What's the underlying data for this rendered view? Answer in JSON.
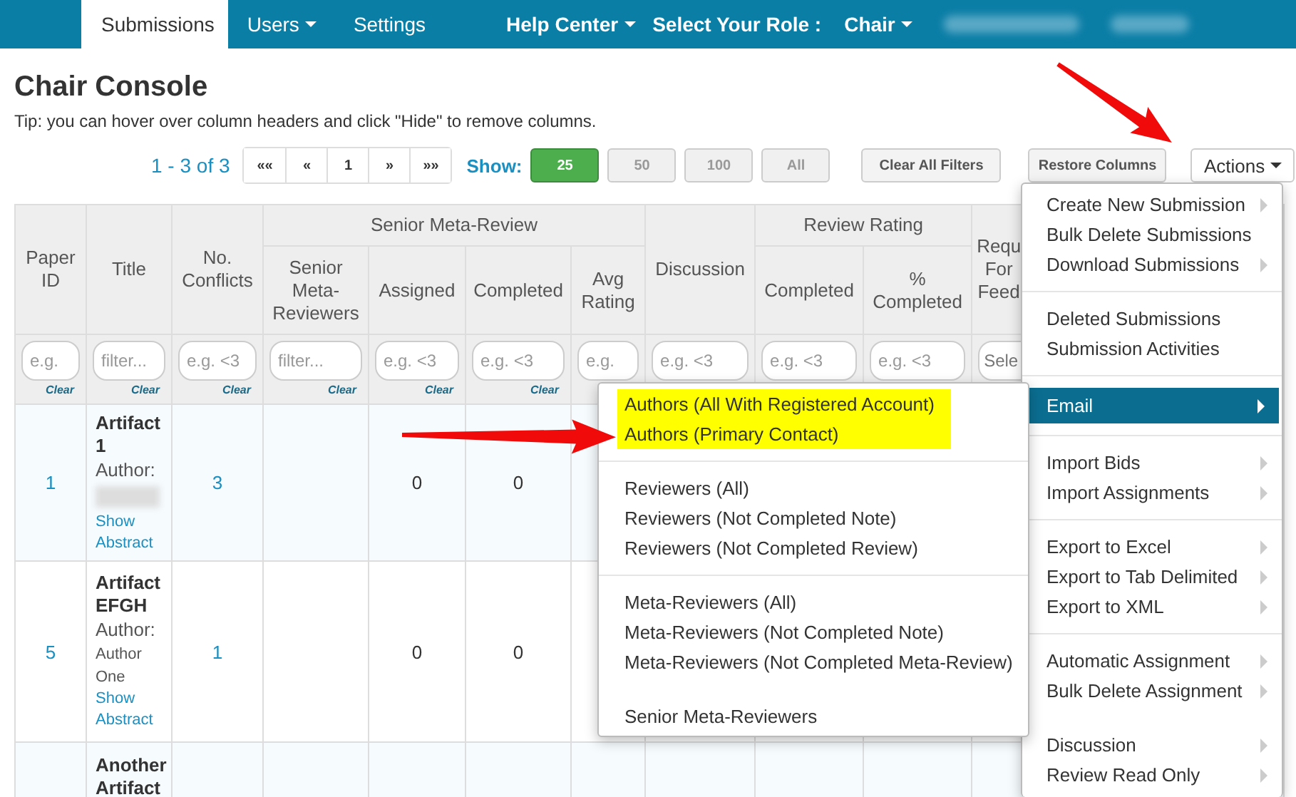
{
  "nav": {
    "tabs": [
      {
        "label": "Submissions",
        "selected": true,
        "dropdown": false
      },
      {
        "label": "Users",
        "selected": false,
        "dropdown": true
      },
      {
        "label": "Settings",
        "selected": false,
        "dropdown": false
      }
    ],
    "right": [
      {
        "kind": "link",
        "label": "Help Center",
        "dropdown": true
      },
      {
        "kind": "label",
        "label": "Select Your Role :"
      },
      {
        "kind": "link",
        "label": "Chair",
        "dropdown": true
      },
      {
        "kind": "redacted"
      },
      {
        "kind": "redacted"
      }
    ]
  },
  "page": {
    "title": "Chair Console",
    "tip": "Tip: you can hover over column headers and click \"Hide\" to remove columns."
  },
  "toolbar": {
    "range": "1 - 3 of 3",
    "pager": [
      "««",
      "«",
      "1",
      "»",
      "»»"
    ],
    "show_label": "Show:",
    "page_sizes": [
      {
        "label": "25",
        "selected": true
      },
      {
        "label": "50",
        "selected": false
      },
      {
        "label": "100",
        "selected": false
      },
      {
        "label": "All",
        "selected": false
      }
    ],
    "buttons": [
      "Clear All Filters",
      "Restore Columns"
    ],
    "actions": {
      "label": "Actions",
      "dropdown": true
    }
  },
  "table": {
    "header": [
      {
        "label": "Paper ID"
      },
      {
        "label": "Title"
      },
      {
        "label": "No. Conflicts"
      },
      {
        "group": "Senior Meta-Review",
        "columns": [
          "Senior Meta-Reviewers",
          "Assigned",
          "Completed",
          "Avg Rating"
        ]
      },
      {
        "label": "Discussion"
      },
      {
        "group": "Review Rating",
        "columns": [
          "Completed",
          "% Completed"
        ]
      },
      {
        "label": "Requ For Feed"
      }
    ],
    "filters": [
      {
        "kind": "text",
        "placeholder": "e.g.",
        "clear": "Clear"
      },
      {
        "kind": "text",
        "placeholder": "filter...",
        "clear": "Clear"
      },
      {
        "kind": "text",
        "placeholder": "e.g. <3",
        "clear": "Clear"
      },
      {
        "kind": "text",
        "placeholder": "filter...",
        "clear": "Clear"
      },
      {
        "kind": "text",
        "placeholder": "e.g. <3",
        "clear": "Clear"
      },
      {
        "kind": "text",
        "placeholder": "e.g. <3",
        "clear": "Clear"
      },
      {
        "kind": "text",
        "placeholder": "e.g."
      },
      {
        "kind": "text",
        "placeholder": "e.g. <3"
      },
      {
        "kind": "text",
        "placeholder": "e.g. <3"
      },
      {
        "kind": "text",
        "placeholder": "e.g. <3"
      },
      {
        "kind": "select",
        "value": "Sele"
      }
    ],
    "rows": [
      {
        "cells": [
          {
            "kind": "link",
            "text": "1"
          },
          {
            "kind": "paper",
            "title": "Artifact 1",
            "author_label": "Author:",
            "author_redacted": true,
            "abstract_link": "Show Abstract"
          },
          {
            "kind": "link",
            "text": "3"
          },
          {
            "kind": "empty"
          },
          {
            "kind": "number",
            "text": "0"
          },
          {
            "kind": "number",
            "text": "0"
          },
          {
            "kind": "empty"
          },
          {
            "kind": "empty"
          },
          {
            "kind": "empty"
          },
          {
            "kind": "empty"
          },
          {
            "kind": "empty"
          }
        ]
      },
      {
        "cells": [
          {
            "kind": "link",
            "text": "5"
          },
          {
            "kind": "paper",
            "title": "Artifact EFGH",
            "author_label": "Author:",
            "author": "Author One",
            "author_redacted": false,
            "abstract_link": "Show Abstract"
          },
          {
            "kind": "link",
            "text": "1"
          },
          {
            "kind": "empty"
          },
          {
            "kind": "number",
            "text": "0"
          },
          {
            "kind": "number",
            "text": "0"
          },
          {
            "kind": "empty"
          },
          {
            "kind": "empty"
          },
          {
            "kind": "empty"
          },
          {
            "kind": "empty"
          },
          {
            "kind": "empty"
          }
        ]
      },
      {
        "cells": [
          {
            "kind": "empty"
          },
          {
            "kind": "paper",
            "title": "Another Artifact"
          },
          {
            "kind": "empty"
          },
          {
            "kind": "empty"
          },
          {
            "kind": "empty"
          },
          {
            "kind": "empty"
          },
          {
            "kind": "empty"
          },
          {
            "kind": "empty"
          },
          {
            "kind": "empty"
          },
          {
            "kind": "empty"
          },
          {
            "kind": "empty"
          }
        ]
      }
    ]
  },
  "actions_menu": {
    "sections": [
      {
        "ruled": true,
        "items": [
          {
            "label": "Create New Submission",
            "submenu": true,
            "selected": false
          },
          {
            "label": "Bulk Delete Submissions",
            "submenu": false,
            "selected": false
          },
          {
            "label": "Download Submissions",
            "submenu": true,
            "selected": false
          }
        ]
      },
      {
        "ruled": true,
        "items": [
          {
            "label": "Deleted Submissions",
            "submenu": false,
            "selected": false
          },
          {
            "label": "Submission Activities",
            "submenu": false,
            "selected": false
          }
        ]
      },
      {
        "ruled": true,
        "items": [
          {
            "label": "Email",
            "submenu": true,
            "selected": true
          }
        ]
      },
      {
        "ruled": true,
        "items": [
          {
            "label": "Import Bids",
            "submenu": true,
            "selected": false
          },
          {
            "label": "Import Assignments",
            "submenu": true,
            "selected": false
          }
        ]
      },
      {
        "ruled": true,
        "items": [
          {
            "label": "Export to Excel",
            "submenu": true,
            "selected": false
          },
          {
            "label": "Export to Tab Delimited",
            "submenu": true,
            "selected": false
          },
          {
            "label": "Export to XML",
            "submenu": true,
            "selected": false
          }
        ]
      },
      {
        "ruled": false,
        "items": [
          {
            "label": "Automatic Assignment",
            "submenu": true,
            "selected": false
          },
          {
            "label": "Bulk Delete Assignment",
            "submenu": true,
            "selected": false
          }
        ]
      },
      {
        "items": [
          {
            "label": "Discussion",
            "submenu": true,
            "selected": false
          },
          {
            "label": "Review Read Only",
            "submenu": true,
            "selected": false
          }
        ]
      }
    ]
  },
  "email_menu": {
    "sections": [
      {
        "highlighted": true,
        "ruled": true,
        "items": [
          "Authors (All With Registered Account)",
          "Authors (Primary Contact)"
        ]
      },
      {
        "highlighted": false,
        "ruled": true,
        "items": [
          "Reviewers (All)",
          "Reviewers (Not Completed Note)",
          "Reviewers (Not Completed Review)"
        ]
      },
      {
        "highlighted": false,
        "ruled": false,
        "items": [
          "Meta-Reviewers (All)",
          "Meta-Reviewers (Not Completed Note)",
          "Meta-Reviewers (Not Completed Meta-Review)"
        ]
      },
      {
        "highlighted": false,
        "items": [
          "Senior Meta-Reviewers"
        ]
      }
    ]
  }
}
